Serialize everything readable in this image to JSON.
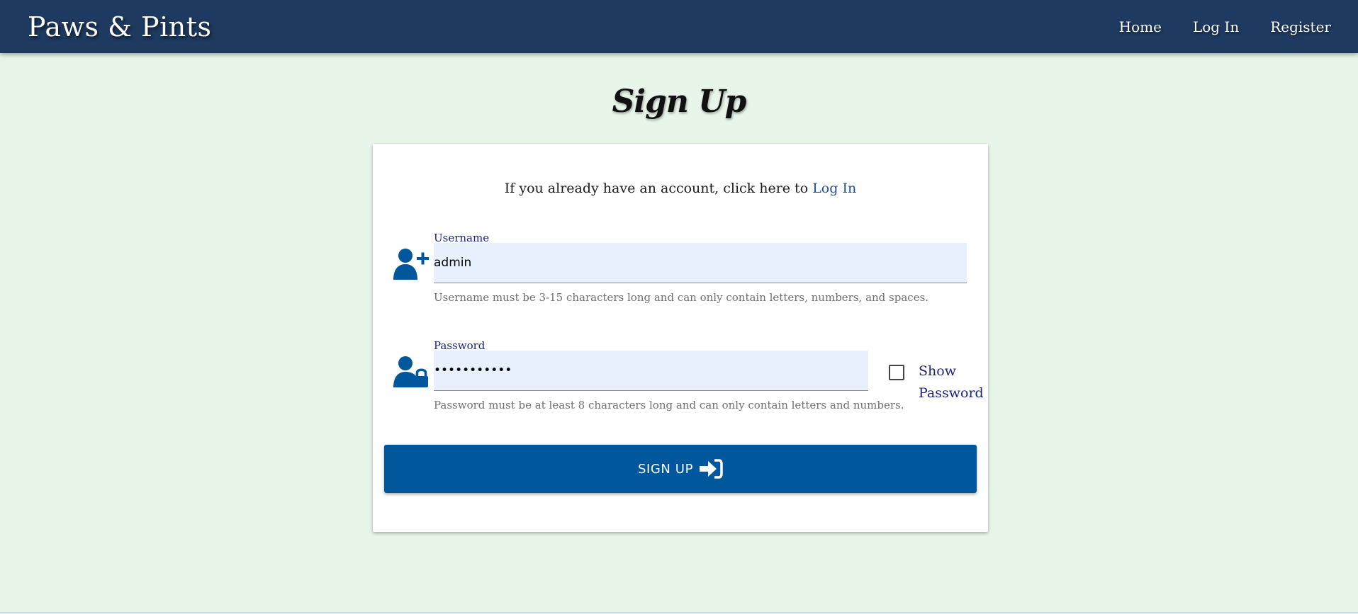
{
  "navbar": {
    "brand": "Paws & Pints",
    "links": [
      {
        "label": "Home"
      },
      {
        "label": "Log In"
      },
      {
        "label": "Register"
      }
    ]
  },
  "page": {
    "title": "Sign Up"
  },
  "form": {
    "login_prompt": "If you already have an account, click here to ",
    "login_link": "Log In",
    "username": {
      "label": "Username",
      "value": "admin",
      "helper": "Username must be 3-15 characters long and can only contain letters, numbers, and spaces.",
      "icon": "user-plus-icon"
    },
    "password": {
      "label": "Password",
      "value": "•••••••••••",
      "helper": "Password must be at least 8 characters long and can only contain letters and numbers.",
      "icon": "user-lock-icon"
    },
    "show_password": {
      "label_line1": "Show",
      "label_line2": "Password",
      "checked": false
    },
    "submit_label": "SIGN UP",
    "submit_icon": "sign-in-icon"
  },
  "colors": {
    "navbar_bg": "#1f3a60",
    "page_bg": "#e8f5e9",
    "accent": "#01579b",
    "input_bg": "#e8f0fe",
    "label": "#1a237e",
    "link": "#1e4d9a"
  }
}
